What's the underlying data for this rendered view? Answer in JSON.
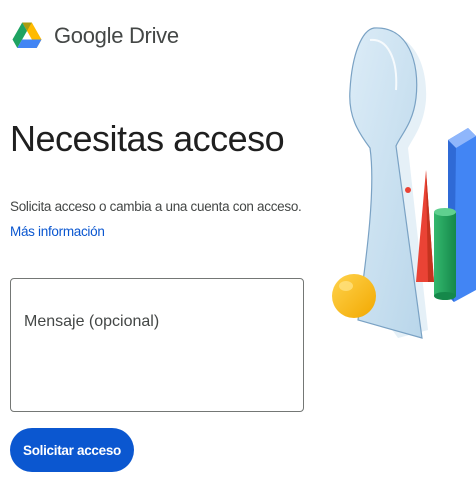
{
  "brand": {
    "logo_icon": "google-drive-logo-icon",
    "name": "Google Drive"
  },
  "main": {
    "heading": "Necesitas acceso",
    "description": "Solicita acceso o cambia a una cuenta con acceso.",
    "learn_more_link": "Más información",
    "message_field": {
      "placeholder": "Mensaje (opcional)",
      "value": ""
    },
    "submit_button": "Solicitar acceso"
  },
  "illustration": {
    "icon": "keyhole-illustration-icon"
  },
  "colors": {
    "accent": "#0b57d0",
    "link": "#0b57d0",
    "text": "#1f1f1f",
    "muted_text": "#444746",
    "border": "#747775",
    "drive_green": "#1ea362",
    "drive_yellow": "#ffba00",
    "drive_blue": "#4285f4",
    "drive_red": "#ea4335"
  }
}
